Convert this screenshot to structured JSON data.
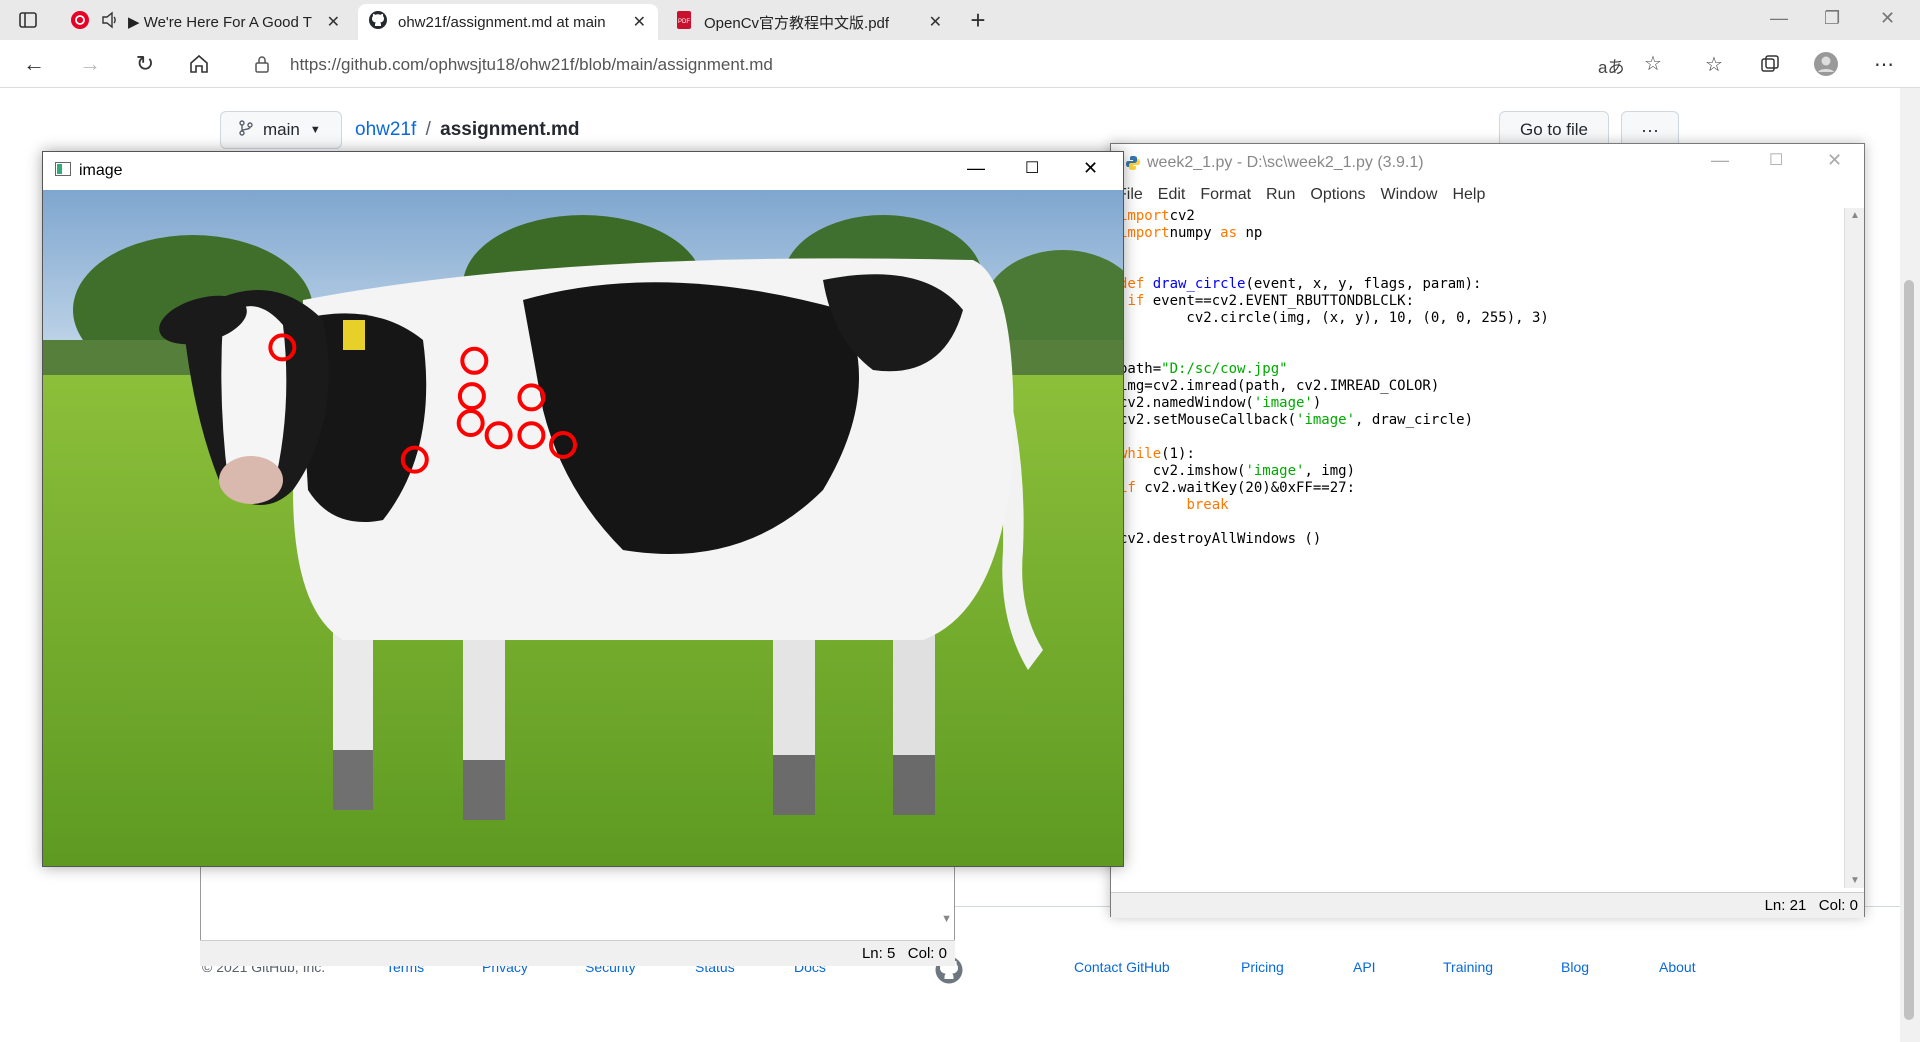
{
  "browser": {
    "tabs": [
      {
        "title": "We're Here For A Good T",
        "active": false,
        "audio": true
      },
      {
        "title": "ohw21f/assignment.md at main",
        "active": true
      },
      {
        "title": "OpenCv官方教程中文版.pdf",
        "active": false
      }
    ],
    "new_tab": "+",
    "url": "https://github.com/ophwsjtu18/ohw21f/blob/main/assignment.md"
  },
  "github": {
    "branch": "main",
    "repo": "ohw21f",
    "separator": "/",
    "file": "assignment.md",
    "goto_file": "Go to file",
    "more": "···",
    "footer": {
      "copyright": "© 2021 GitHub, Inc.",
      "left_links": [
        "Terms",
        "Privacy",
        "Security",
        "Status",
        "Docs"
      ],
      "right_links": [
        "Contact GitHub",
        "Pricing",
        "API",
        "Training",
        "Blog",
        "About"
      ]
    }
  },
  "bg_idle": {
    "status": "Ln: 5   Col: 0"
  },
  "idle": {
    "title": "week2_1.py - D:\\sc\\week2_1.py (3.9.1)",
    "menu": [
      "File",
      "Edit",
      "Format",
      "Run",
      "Options",
      "Window",
      "Help"
    ],
    "status": "Ln: 21   Col: 0",
    "code": [
      [
        [
          "kw",
          "import"
        ],
        [
          "",
          "cv2"
        ]
      ],
      [
        [
          "kw",
          "import"
        ],
        [
          "",
          "numpy "
        ],
        [
          "kw",
          "as"
        ],
        [
          "",
          " np"
        ]
      ],
      [],
      [],
      [
        [
          "kw",
          "def"
        ],
        [
          "",
          " "
        ],
        [
          "fn",
          "draw_circle"
        ],
        [
          "",
          "(event, x, y, flags, param):"
        ]
      ],
      [
        [
          "",
          " "
        ],
        [
          "kw",
          "if"
        ],
        [
          "",
          " event==cv2.EVENT_RBUTTONDBLCLK:"
        ]
      ],
      [
        [
          "",
          "        cv2.circle(img, (x, y), 10, (0, 0, 255), 3)"
        ]
      ],
      [],
      [],
      [
        [
          "",
          "path="
        ],
        [
          "str",
          "\"D:/sc/cow.jpg\""
        ]
      ],
      [
        [
          "",
          "img=cv2.imread(path, cv2.IMREAD_COLOR)"
        ]
      ],
      [
        [
          "",
          "cv2.namedWindow("
        ],
        [
          "str",
          "'image'"
        ],
        [
          "",
          ")"
        ]
      ],
      [
        [
          "",
          "cv2.setMouseCallback("
        ],
        [
          "str",
          "'image'"
        ],
        [
          "",
          ", draw_circle)"
        ]
      ],
      [],
      [
        [
          "kw",
          "while"
        ],
        [
          "",
          "(1):"
        ]
      ],
      [
        [
          "",
          "    cv2.imshow("
        ],
        [
          "str",
          "'image'"
        ],
        [
          "",
          ", img)"
        ]
      ],
      [
        [
          "",
          ""
        ],
        [
          "kw",
          "if"
        ],
        [
          "",
          " cv2.waitKey(20)&0xFF==27:"
        ]
      ],
      [
        [
          "",
          "        "
        ],
        [
          "kw",
          "break"
        ]
      ],
      [],
      [
        [
          "",
          "cv2.destroyAllWindows ()"
        ]
      ]
    ]
  },
  "cv_window": {
    "title": "image",
    "circle_color": "#ff0000"
  },
  "colors": {
    "link": "#0969da",
    "keyword": "#ff7700",
    "builtin_fn": "#0000ff",
    "string": "#00aa00"
  }
}
